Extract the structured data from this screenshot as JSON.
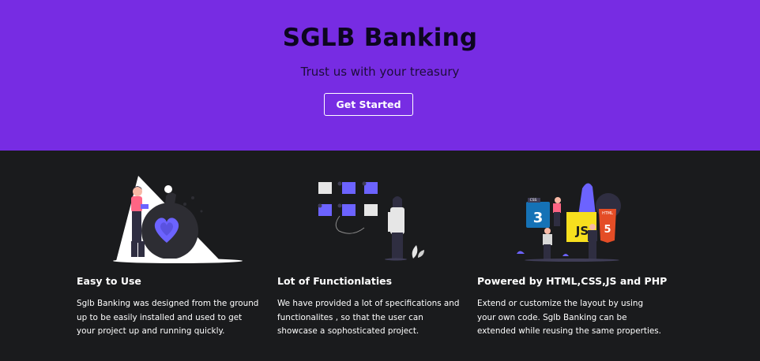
{
  "hero": {
    "title": "SGLB Banking",
    "subtitle": "Trust us with your treasury",
    "cta_label": "Get Started",
    "background_color": "#772ce3"
  },
  "features": [
    {
      "title": "Easy to Use",
      "text": "Sglb Banking was designed from the ground up to be easily installed and used to get your project up and running quickly.",
      "illustration": "woman-holding-heart-bag-illustration"
    },
    {
      "title": "Lot of Functionlaties",
      "text": "We have provided a lot of specifications and functionalites , so that the user can showcase a sophosticated project.",
      "illustration": "woman-with-squares-grid-illustration"
    },
    {
      "title": "Powered by HTML,CSS,JS and PHP",
      "text": "Extend or customize the layout by using your own code. Sglb Banking can be extended while reusing the same properties.",
      "illustration": "people-with-html-css-js-logos-illustration",
      "logo_labels": [
        "CSS",
        "JS",
        "HTML"
      ]
    }
  ],
  "colors": {
    "accent": "#6c63ff",
    "dark_bg": "#1a1b1d",
    "html_orange": "#e44d26",
    "css_blue": "#1572b6",
    "js_yellow": "#f7df1e"
  }
}
